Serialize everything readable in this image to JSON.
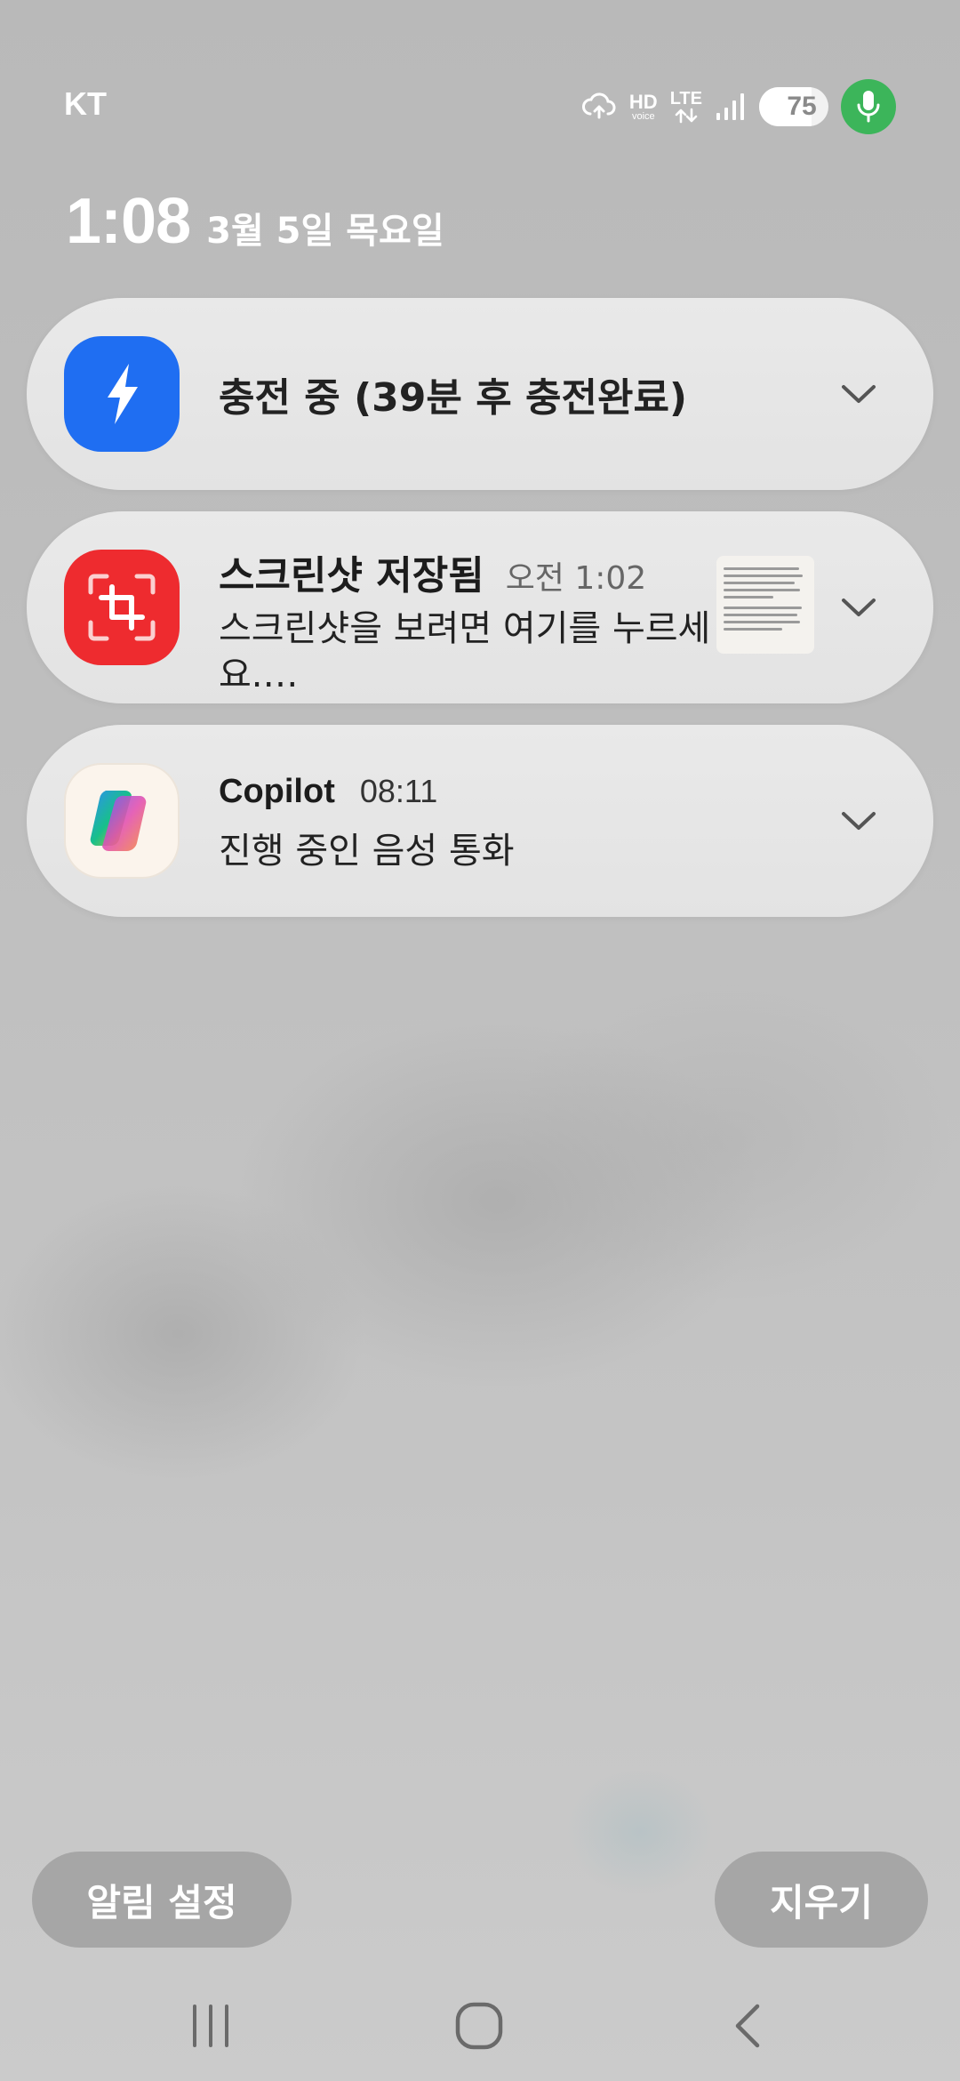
{
  "status_bar": {
    "carrier": "KT",
    "hd_label": "HD",
    "hd_sub": "voice",
    "lte_label": "LTE",
    "battery_level": "75",
    "battery_fraction": 0.75,
    "icons": [
      "cloud-sync-icon",
      "hd-voice-icon",
      "lte-icon",
      "signal-icon",
      "battery-charging-icon",
      "mic-icon"
    ],
    "mic_color": "#3cb55a"
  },
  "header": {
    "time": "1:08",
    "date": "3월 5일 목요일"
  },
  "notifications": [
    {
      "app_icon": "charging-bolt-icon",
      "icon_color": "#1f6ef2",
      "title": "충전 중 (39분 후 충전완료)"
    },
    {
      "app_icon": "screenshot-icon",
      "icon_color": "#ee2b2f",
      "title": "스크린샷 저장됨",
      "time": "오전 1:02",
      "body": "스크린샷을 보려면 여기를 누르세요.…"
    },
    {
      "app_icon": "copilot-icon",
      "app_name": "Copilot",
      "time": "08:11",
      "body": "진행 중인 음성 통화"
    }
  ],
  "buttons": {
    "settings": "알림 설정",
    "clear": "지우기"
  },
  "nav": {
    "icons": [
      "recent-apps-icon",
      "home-icon",
      "back-icon"
    ]
  }
}
